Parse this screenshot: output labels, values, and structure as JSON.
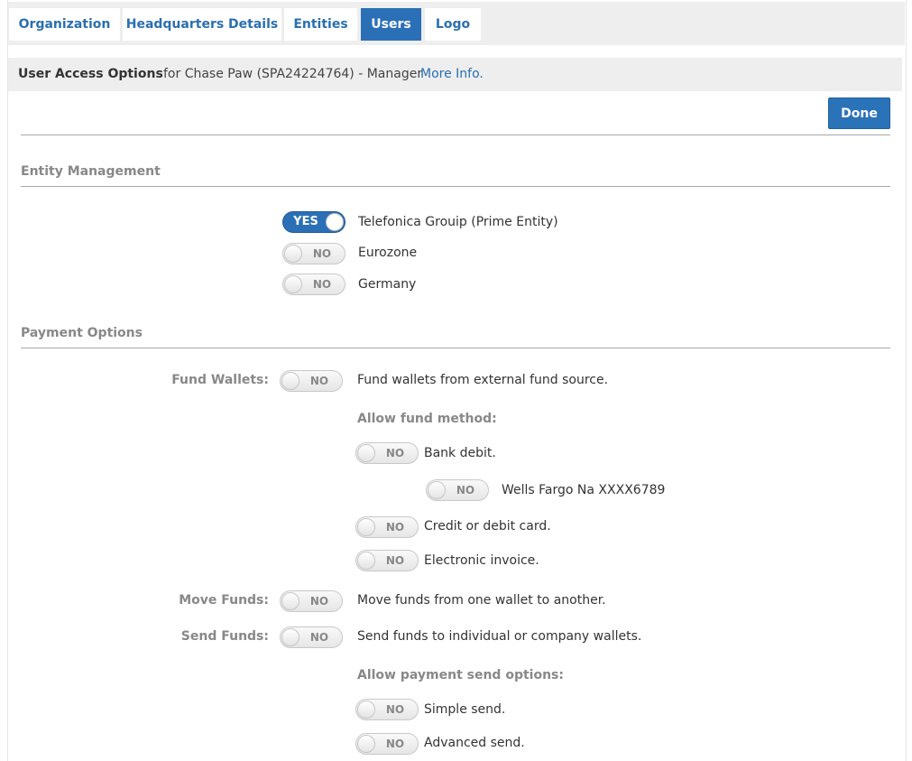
{
  "tabs": [
    {
      "label": "Organization"
    },
    {
      "label": "Headquarters Details"
    },
    {
      "label": "Entities"
    },
    {
      "label": "Users"
    },
    {
      "label": "Logo"
    }
  ],
  "header": {
    "title": "User Access Options",
    "subtitle": "for Chase Paw (SPA24224764)  - Manager",
    "more_info": "More Info."
  },
  "done_label": "Done",
  "entity_management": {
    "title": "Entity Management",
    "entities": [
      {
        "state": "YES",
        "label": "Telefonica Grouip (Prime Entity)"
      },
      {
        "state": "NO",
        "label": "Eurozone"
      },
      {
        "state": "NO",
        "label": "Germany"
      }
    ]
  },
  "payment_options": {
    "title": "Payment Options",
    "fund_wallets": {
      "label": "Fund Wallets:",
      "state": "NO",
      "description": "Fund wallets from external fund source."
    },
    "allow_fund_method": "Allow fund method:",
    "bank_debit": {
      "state": "NO",
      "label": "Bank debit."
    },
    "bank_account": {
      "state": "NO",
      "label": "Wells Fargo Na XXXX6789"
    },
    "card": {
      "state": "NO",
      "label": "Credit or debit card."
    },
    "invoice": {
      "state": "NO",
      "label": "Electronic invoice."
    },
    "move_funds": {
      "label": "Move Funds:",
      "state": "NO",
      "description": "Move funds from one wallet to another."
    },
    "send_funds": {
      "label": "Send Funds:",
      "state": "NO",
      "description": "Send funds to individual or company wallets."
    },
    "allow_send_options": "Allow payment send options:",
    "simple_send": {
      "state": "NO",
      "label": "Simple send."
    },
    "advanced_send": {
      "state": "NO",
      "label": "Advanced send."
    }
  }
}
